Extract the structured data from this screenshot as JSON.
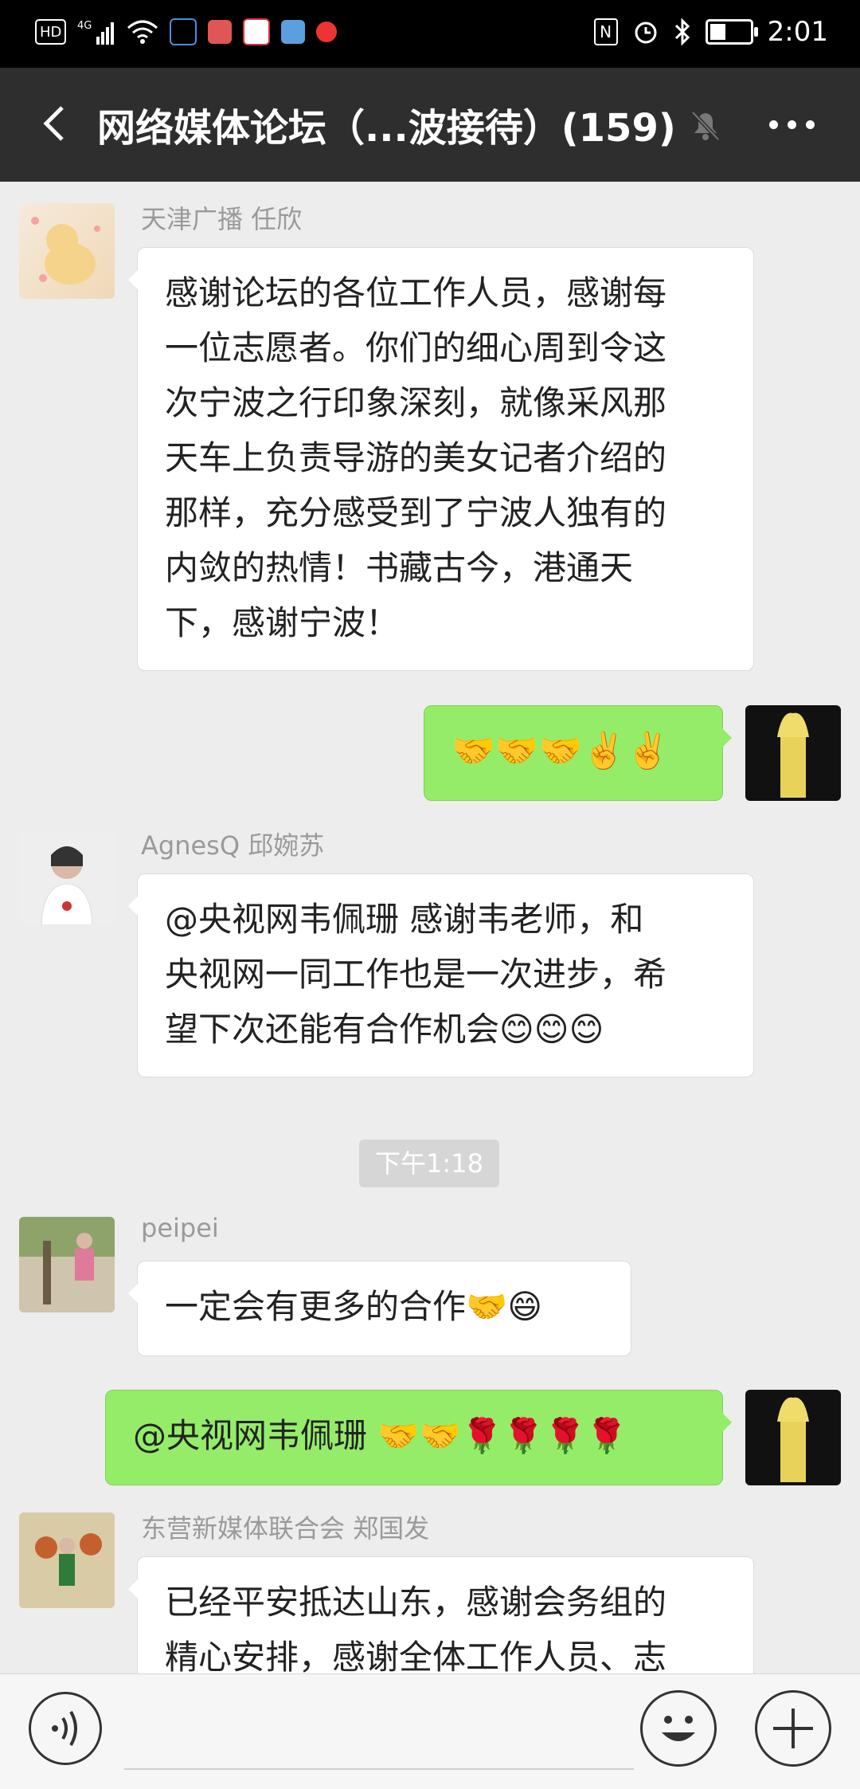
{
  "status_bar": {
    "left_labels": [
      "HD",
      "4G"
    ],
    "time": "2:01",
    "battery_level": 0.35
  },
  "header": {
    "title": "网络媒体论坛（...波接待）(159)",
    "back_icon": "chevron-left-icon",
    "mute_icon": "bell-muted-icon",
    "more_icon": "ellipsis-icon"
  },
  "messages": [
    {
      "sender": "天津广播 任欣",
      "lines": [
        "感谢论坛的各位工作人员，感谢每",
        "一位志愿者。你们的细心周到令这",
        "次宁波之行印象深刻，就像采风那",
        "天车上负责导游的美女记者介绍的",
        "那样，充分感受到了宁波人独有的",
        "内敛的热情！书藏古今，港通天",
        "下，感谢宁波！"
      ]
    },
    {
      "text": "🤝🤝🤝✌️✌️"
    },
    {
      "sender": "AgnesQ 邱婉苏",
      "lines": [
        "@央视网韦佩珊  感谢韦老师，和",
        "央视网一同工作也是一次进步，希",
        "望下次还能有合作机会😊😊😊"
      ]
    },
    {
      "time": "下午1:18"
    },
    {
      "sender": "peipei",
      "text": "一定会有更多的合作🤝😄"
    },
    {
      "text": "@央视网韦佩珊 🤝🤝🌹🌹🌹🌹"
    },
    {
      "sender": "东营新媒体联合会 郑国发",
      "lines": [
        "已经平安抵达山东，感谢会务组的",
        "精心安排，感谢全体工作人员、志"
      ]
    }
  ],
  "input_bar": {
    "voice_icon": "voice-icon",
    "emoji_icon": "emoji-icon",
    "plus_icon": "plus-icon"
  }
}
